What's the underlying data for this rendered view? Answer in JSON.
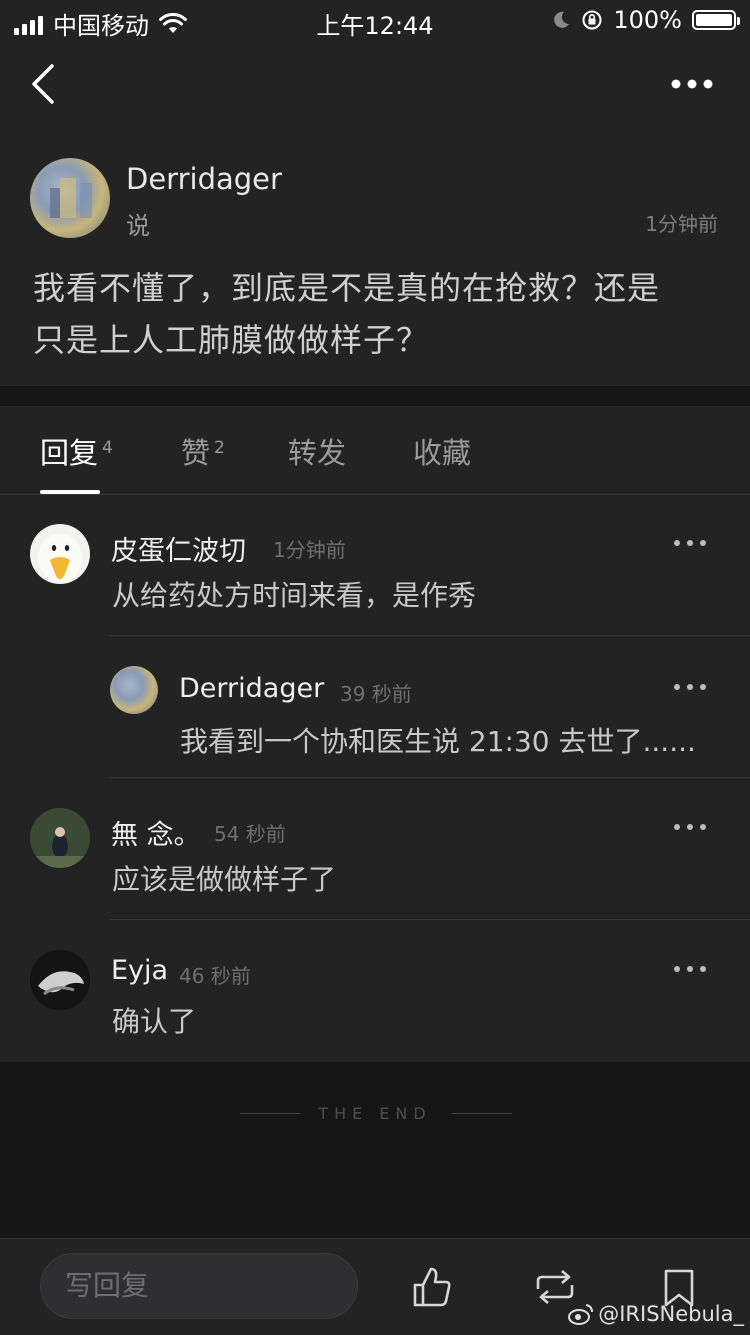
{
  "status_bar": {
    "carrier": "中国移动",
    "time": "上午12:44",
    "battery": "100%"
  },
  "post": {
    "author": "Derridager",
    "action": "说",
    "time": "1分钟前",
    "text_line1": "我看不懂了，到底是不是真的在抢救？还是",
    "text_line2": "只是上人工肺膜做做样子？"
  },
  "tabs": [
    {
      "label": "回复",
      "count": "4"
    },
    {
      "label": "赞",
      "count": "2"
    },
    {
      "label": "转发"
    },
    {
      "label": "收藏"
    }
  ],
  "comments": [
    {
      "name": "皮蛋仁波切",
      "time": "1分钟前",
      "text": "从给药处方时间来看，是作秀"
    },
    {
      "name": "Derridager",
      "time": "39 秒前",
      "text": "我看到一个协和医生说 21:30 去世了......"
    },
    {
      "name": "無 念。",
      "time": "54 秒前",
      "text": "应该是做做样子了"
    },
    {
      "name": "Eyja",
      "time": "46 秒前",
      "text": "确认了"
    }
  ],
  "end_label": "THE END",
  "bottom_bar": {
    "reply_placeholder": "写回复"
  },
  "watermark": "@IRISNebula_"
}
